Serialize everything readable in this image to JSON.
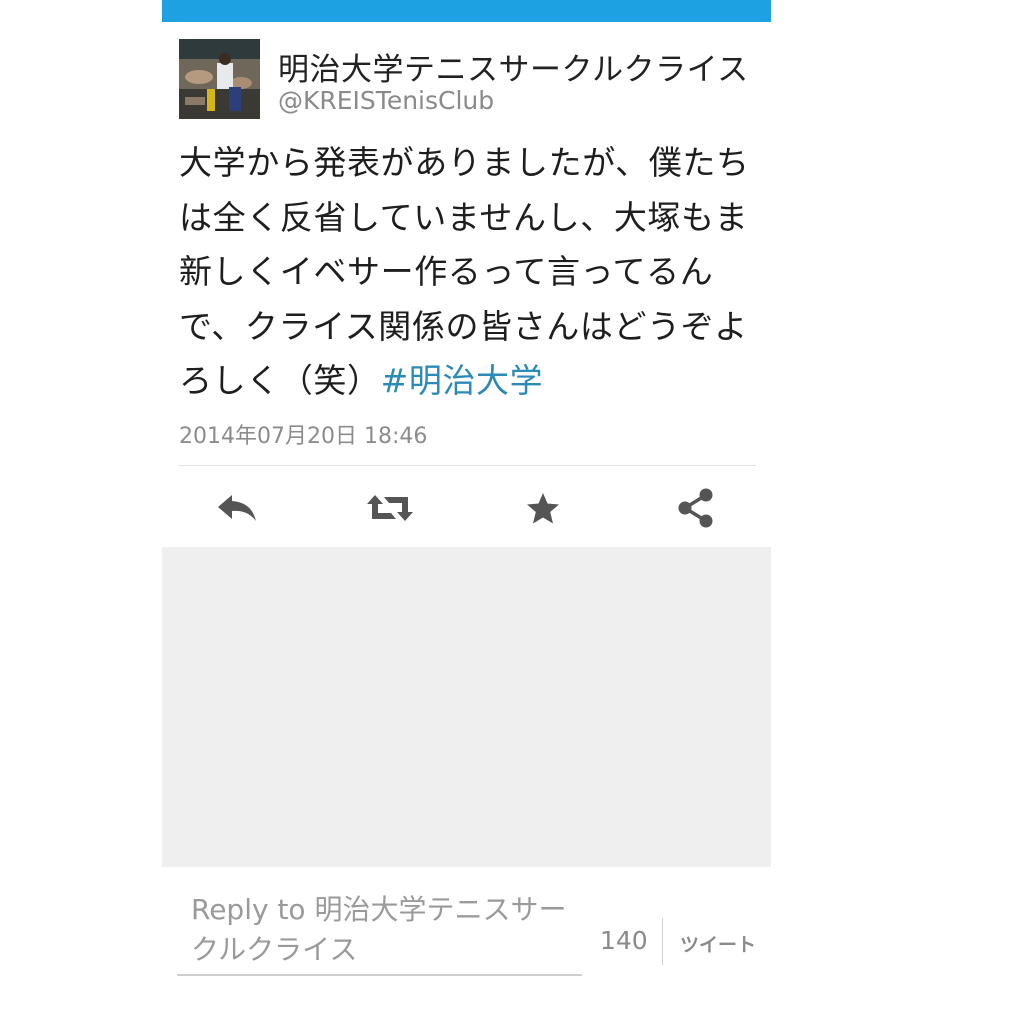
{
  "tweet": {
    "display_name": "明治大学テニスサークルクライス",
    "handle": "@KREISTenisClub",
    "text_lines": [
      "大学から発表がありましたが、僕たち",
      "は全く反省していませんし、大塚もま",
      "新しくイベサー作るって言ってるん",
      "で、クライス関係の皆さんはどうぞよ"
    ],
    "last_line_text": "ろしく（笑）",
    "hashtag": "#明治大学",
    "timestamp": "2014年07月20日 18:46"
  },
  "actions": [
    {
      "name": "reply",
      "icon": "reply-icon"
    },
    {
      "name": "retweet",
      "icon": "retweet-icon"
    },
    {
      "name": "favorite",
      "icon": "star-icon"
    },
    {
      "name": "share",
      "icon": "share-icon"
    }
  ],
  "reply_composer": {
    "placeholder": "Reply to 明治大学テニスサークルクライス",
    "char_count": "140",
    "tweet_button_label": "ツイート"
  },
  "colors": {
    "accent_bar": "#1da1e2",
    "hashtag": "#2b8ab6",
    "icon": "#555555"
  }
}
